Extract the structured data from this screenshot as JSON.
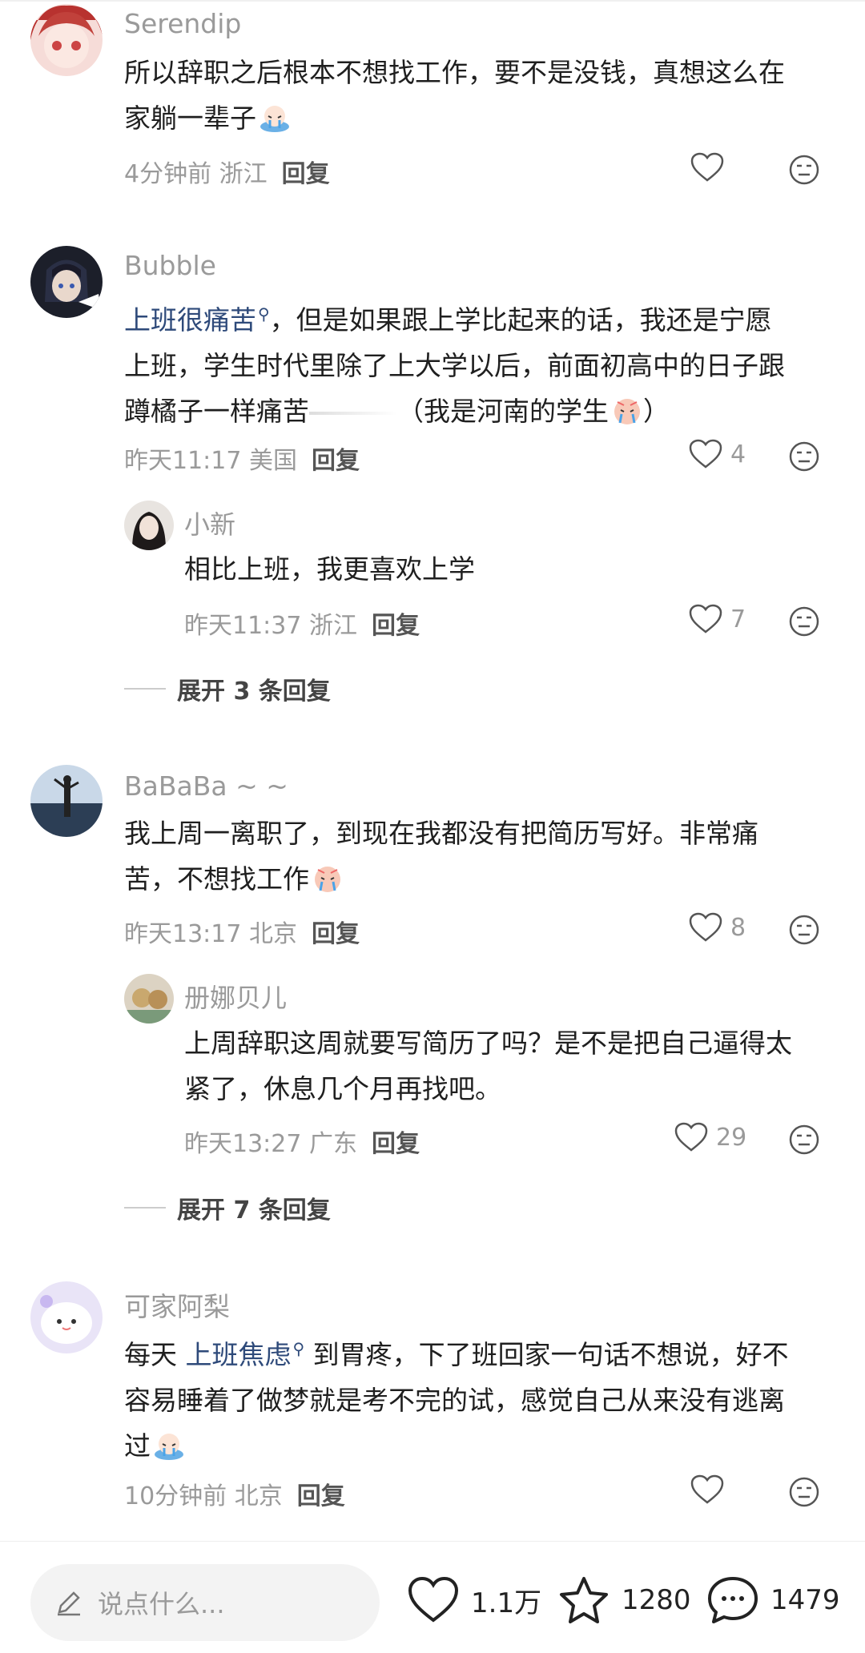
{
  "comments": [
    {
      "username": "Serendip",
      "text_parts": [
        "所以辞职之后根本不想找工作，要不是没钱，真想这么在",
        "家躺一辈子"
      ],
      "time": "4分钟前",
      "location": "浙江",
      "reply_label": "回复",
      "likes": ""
    },
    {
      "username": "Bubble",
      "link": "上班很痛苦",
      "text_parts": [
        "，但是如果跟上学比起来的话，我还是宁愿",
        "上班，学生时代里除了上大学以后，前面初高中的日子跟",
        "蹲橘子一样痛苦",
        "（我是河南的学生",
        "）"
      ],
      "time": "昨天11:17",
      "location": "美国",
      "reply_label": "回复",
      "likes": "4",
      "reply": {
        "username": "小新",
        "text": "相比上班，我更喜欢上学",
        "time": "昨天11:37",
        "location": "浙江",
        "reply_label": "回复",
        "likes": "7"
      },
      "expand_label": "展开 3 条回复"
    },
    {
      "username": "BaBaBa ~ ~",
      "text_parts": [
        "我上周一离职了，到现在我都没有把简历写好。非常痛",
        "苦，不想找工作"
      ],
      "time": "昨天13:17",
      "location": "北京",
      "reply_label": "回复",
      "likes": "8",
      "reply": {
        "username": "册娜贝儿",
        "text_parts": [
          "上周辞职这周就要写简历了吗？是不是把自己逼得太",
          "紧了，休息几个月再找吧。"
        ],
        "time": "昨天13:27",
        "location": "广东",
        "reply_label": "回复",
        "likes": "29"
      },
      "expand_label": "展开 7 条回复"
    },
    {
      "username": "可家阿梨",
      "text_parts": [
        "每天 ",
        "到胃疼，下了班回家一句话不想说，好不",
        "容易睡着了做梦就是考不完的试，感觉自己从来没有逃离",
        "过"
      ],
      "link": "上班焦虑",
      "time": "10分钟前",
      "location": "北京",
      "reply_label": "回复",
      "likes": ""
    }
  ],
  "bottom_bar": {
    "input_placeholder": "说点什么...",
    "likes": "1.1万",
    "favorites": "1280",
    "comments": "1479"
  },
  "icons": {
    "like": "heart-icon",
    "dislike": "dislike-face-icon",
    "favorite": "star-icon",
    "comment": "chat-bubble-icon",
    "edit": "pencil-icon"
  }
}
